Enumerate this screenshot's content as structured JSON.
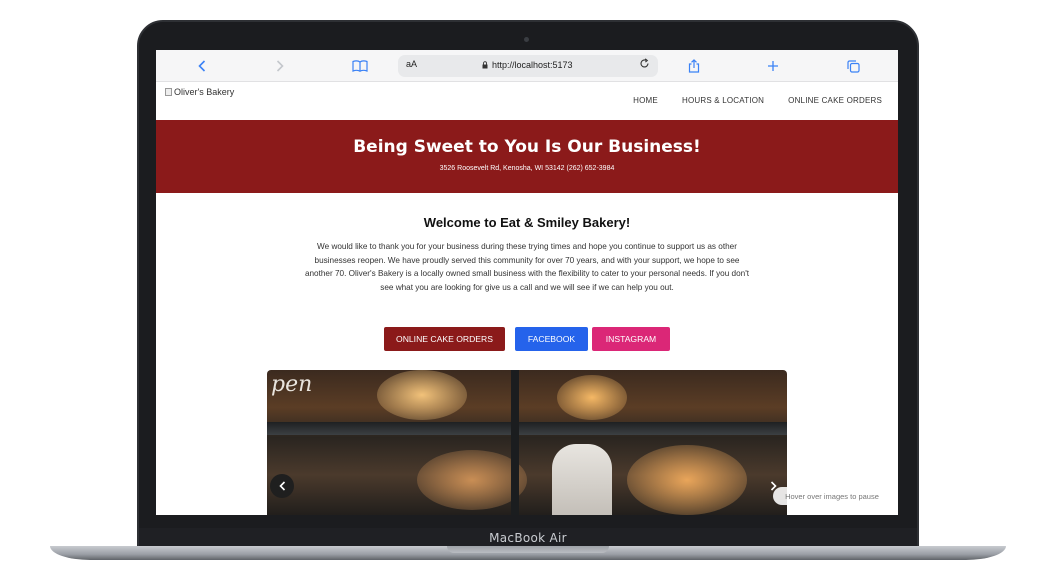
{
  "device": {
    "label": "MacBook Air"
  },
  "browser": {
    "text_size_label": "aA",
    "url": "http://localhost:5173",
    "icons": [
      "chevron-left-icon",
      "chevron-right-icon",
      "book-icon",
      "lock-icon",
      "reload-icon",
      "share-icon",
      "plus-icon",
      "tabs-icon"
    ]
  },
  "site": {
    "logo_alt": "Oliver's Bakery",
    "nav": [
      {
        "label": "HOME"
      },
      {
        "label": "HOURS & LOCATION"
      },
      {
        "label": "ONLINE CAKE ORDERS"
      }
    ],
    "hero": {
      "title": "Being Sweet to You Is Our Business!",
      "address": "3526 Roosevelt Rd, Kenosha, WI 53142 (262) 652-3984"
    },
    "welcome": {
      "title": "Welcome to Eat & Smiley Bakery!",
      "text": "We would like to thank you for your business during these trying times and hope you continue to support us as other businesses reopen. We have proudly served this community for over 70 years, and with your support, we hope to see another 70. Oliver's Bakery is a locally owned small business with the flexibility to cater to your personal needs. If you don't see what you are looking for give us a call and we will see if we can help you out."
    },
    "buttons": {
      "cake": "ONLINE CAKE ORDERS",
      "facebook": "FACEBOOK",
      "instagram": "INSTAGRAM"
    },
    "carousel": {
      "sign_text": "pen",
      "hint": "Hover over images to pause"
    }
  },
  "colors": {
    "brand_red": "#8b1a1a",
    "facebook_blue": "#2563eb",
    "instagram_pink": "#db2777"
  }
}
